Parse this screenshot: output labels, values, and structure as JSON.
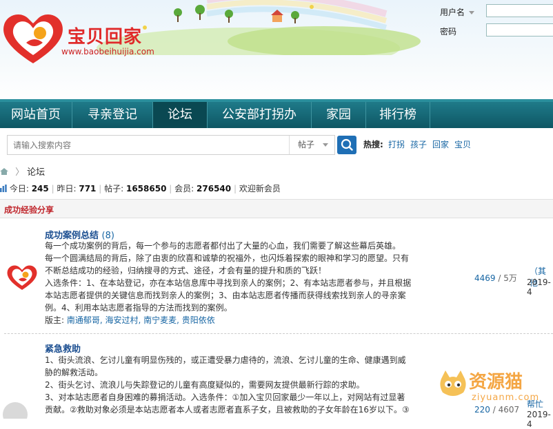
{
  "site": {
    "name": "宝贝回家",
    "url": "www.baobeihuijia.com"
  },
  "login": {
    "username_label": "用户名",
    "password_label": "密码"
  },
  "nav": {
    "items": [
      "网站首页",
      "寻亲登记",
      "论坛",
      "公安部打拐办",
      "家园",
      "排行榜"
    ],
    "active": "论坛"
  },
  "search": {
    "placeholder": "请输入搜索内容",
    "type": "帖子",
    "hot_label": "热搜:",
    "hot_terms": [
      "打拐",
      "孩子",
      "回家",
      "宝贝"
    ]
  },
  "breadcrumb": {
    "current": "论坛"
  },
  "stats": {
    "today_label": "今日:",
    "today": "245",
    "yesterday_label": "昨日:",
    "yesterday": "771",
    "posts_label": "帖子:",
    "posts": "1658650",
    "members_label": "会员:",
    "members": "276540",
    "welcome": "欢迎新会员"
  },
  "section": {
    "title": "成功经验分享"
  },
  "forums": [
    {
      "title": "成功案例总结",
      "count": "(8)",
      "lines": [
        "每一个成功案例的背后，每一个参与的志愿者都付出了大量的心血，我们需要了解这些幕后英雄。",
        "每一个圆满结局的背后，除了由衷的欣喜和诚挚的祝福外，也闪烁着探索的眼神和学习的愿望。只有",
        "不断总结成功的经验，归纳搜寻的方式、途径，才会有量的提升和质的飞跃！",
        "入选条件：1、在本站登记，亦在本站信息库中寻找到亲人的案例；2、有本站志愿者参与，并且根据",
        "本站志愿者提供的关键信息而找到亲人的案例；3、由本站志愿者传播而获得线索找到亲人的寻亲案",
        "例。4、利用本站志愿者指导的方法而找到的案例。"
      ],
      "moderator_label": "版主:",
      "moderators": "南通郁哥, 海安过村, 南宁麦麦, 贵阳依依",
      "threads": "4469",
      "posts": "5万",
      "last_post": "（其他",
      "last_date": "2019-4"
    },
    {
      "title": "紧急救助",
      "lines": [
        "1、街头流浪、乞讨儿童有明显伤残的，或正遭受暴力虐待的，流浪、乞讨儿童的生命、健康遇到威",
        "胁的解救活动。",
        "2、街头乞讨、流浪儿与失踪登记的儿童有高度疑似的，需要网友提供最新行踪的求助。",
        "3、对本站志愿者自身困难的募捐活动。入选条件：①加入宝贝回家最少一年以上，对网站有过显著",
        "贡献。②救助对象必须是本站志愿者本人或者志愿者直系子女，且被救助的子女年龄在16岁以下。③"
      ],
      "threads": "220",
      "posts": "4607",
      "last_post": "帮忙",
      "last_date": "2019-4"
    }
  ],
  "watermark": {
    "text": "资源猫",
    "sub": "ziyuanm.com"
  }
}
